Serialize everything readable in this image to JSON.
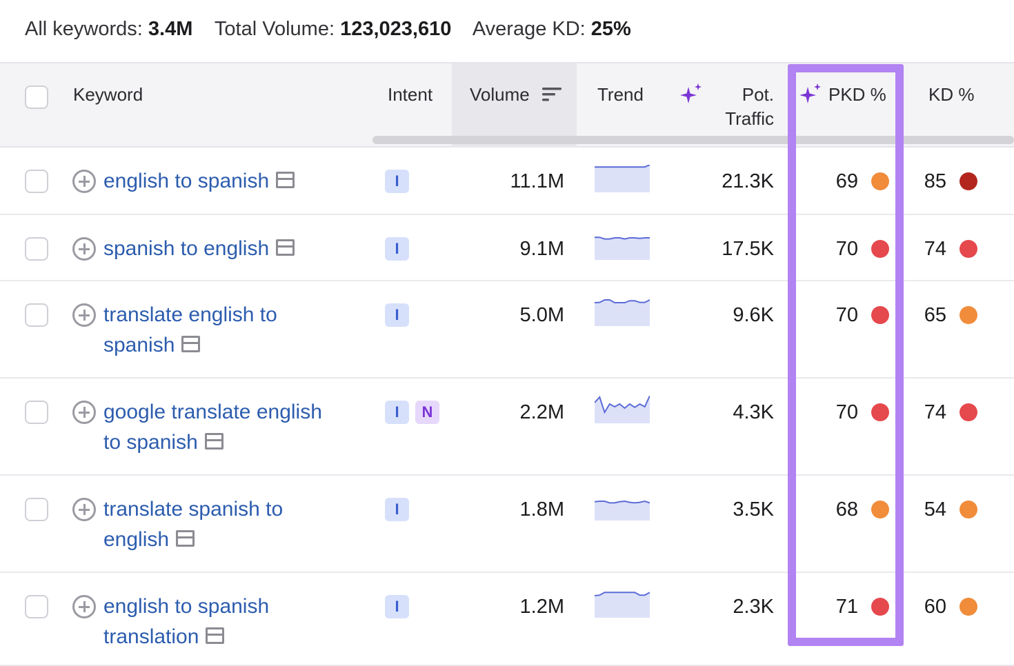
{
  "summary": {
    "all_keywords_label": "All keywords:",
    "all_keywords_value": "3.4M",
    "total_volume_label": "Total Volume:",
    "total_volume_value": "123,023,610",
    "average_kd_label": "Average KD:",
    "average_kd_value": "25%"
  },
  "columns": {
    "keyword": "Keyword",
    "intent": "Intent",
    "volume": "Volume",
    "trend": "Trend",
    "pot_traffic_line1": "Pot.",
    "pot_traffic_line2": "Traffic",
    "pkd": "PKD %",
    "kd": "KD %"
  },
  "colors": {
    "link": "#2c5cae",
    "highlight_border": "#b283f2",
    "sparkle": "#7b35d6",
    "kd_orange": "#f08c3a",
    "kd_red": "#e5484d",
    "kd_dark_red": "#b3261e",
    "trend_fill": "#dde1f8",
    "trend_line": "#5b6bd6"
  },
  "icons": {
    "row_add": "plus-circle-icon",
    "serp": "serp-features-icon",
    "sort": "sort-descending-icon",
    "ai": "ai-sparkle-icon"
  },
  "rows": [
    {
      "keyword_line1": "english to spanish",
      "keyword_line2": "",
      "intents": [
        "I"
      ],
      "volume": "11.1M",
      "trend": [
        0.92,
        0.92,
        0.92,
        0.92,
        0.92,
        0.92,
        0.92,
        0.92,
        0.92,
        0.92,
        0.92,
        1.0
      ],
      "pot_traffic": "21.3K",
      "pkd": "69",
      "pkd_color": "#f08c3a",
      "kd": "85",
      "kd_color": "#b3261e"
    },
    {
      "keyword_line1": "spanish to english",
      "keyword_line2": "",
      "intents": [
        "I"
      ],
      "volume": "9.1M",
      "trend": [
        0.82,
        0.82,
        0.76,
        0.76,
        0.8,
        0.8,
        0.76,
        0.8,
        0.8,
        0.78,
        0.8,
        0.8
      ],
      "pot_traffic": "17.5K",
      "pkd": "70",
      "pkd_color": "#e5484d",
      "kd": "74",
      "kd_color": "#e5484d"
    },
    {
      "keyword_line1": "translate english to",
      "keyword_line2": "spanish",
      "intents": [
        "I"
      ],
      "volume": "5.0M",
      "trend": [
        0.85,
        0.86,
        0.95,
        0.95,
        0.85,
        0.85,
        0.85,
        0.92,
        0.92,
        0.86,
        0.86,
        0.95
      ],
      "pot_traffic": "9.6K",
      "pkd": "70",
      "pkd_color": "#e5484d",
      "kd": "65",
      "kd_color": "#f08c3a"
    },
    {
      "keyword_line1": "google translate english",
      "keyword_line2": "to spanish",
      "intents": [
        "I",
        "N"
      ],
      "volume": "2.2M",
      "trend": [
        0.75,
        0.95,
        0.4,
        0.7,
        0.6,
        0.7,
        0.55,
        0.7,
        0.58,
        0.7,
        0.6,
        1.0
      ],
      "pot_traffic": "4.3K",
      "pkd": "70",
      "pkd_color": "#e5484d",
      "kd": "74",
      "kd_color": "#e5484d"
    },
    {
      "keyword_line1": "translate spanish to",
      "keyword_line2": "english",
      "intents": [
        "I"
      ],
      "volume": "1.8M",
      "trend": [
        0.68,
        0.7,
        0.7,
        0.64,
        0.64,
        0.68,
        0.7,
        0.66,
        0.64,
        0.66,
        0.7,
        0.64
      ],
      "pot_traffic": "3.5K",
      "pkd": "68",
      "pkd_color": "#f08c3a",
      "kd": "54",
      "kd_color": "#f08c3a"
    },
    {
      "keyword_line1": "english to spanish",
      "keyword_line2": "translation",
      "intents": [
        "I"
      ],
      "volume": "1.2M",
      "trend": [
        0.8,
        0.82,
        0.92,
        0.92,
        0.92,
        0.92,
        0.92,
        0.92,
        0.92,
        0.82,
        0.82,
        0.92
      ],
      "pot_traffic": "2.3K",
      "pkd": "71",
      "pkd_color": "#e5484d",
      "kd": "60",
      "kd_color": "#f08c3a"
    }
  ]
}
